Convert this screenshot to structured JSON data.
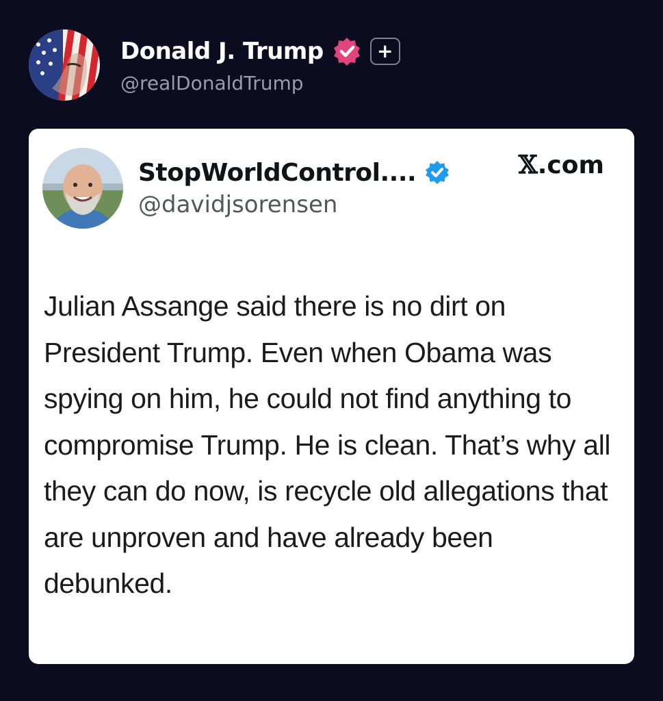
{
  "post": {
    "author_name": "Donald J. Trump",
    "author_handle": "@realDonaldTrump",
    "plus_label": "+"
  },
  "quote": {
    "author_name": "StopWorldControl....",
    "author_handle": "@davidjsorensen",
    "source": ".com",
    "source_mark": "𝕏",
    "text": "Julian Assange said there is no dirt on President Trump. Even when Obama was spying on him, he could not find anything to compromise Trump. He is clean. That’s why all they can do now, is recycle old allegations that are unproven and have already been debunked."
  },
  "colors": {
    "background": "#0b0c1f",
    "card": "#ffffff",
    "verified_pink": "#e0457b",
    "verified_blue": "#1d9bf0"
  },
  "icons": [
    "avatar-flag-portrait",
    "verified-badge-pink",
    "plus-badge",
    "avatar-portrait",
    "verified-badge-blue"
  ]
}
